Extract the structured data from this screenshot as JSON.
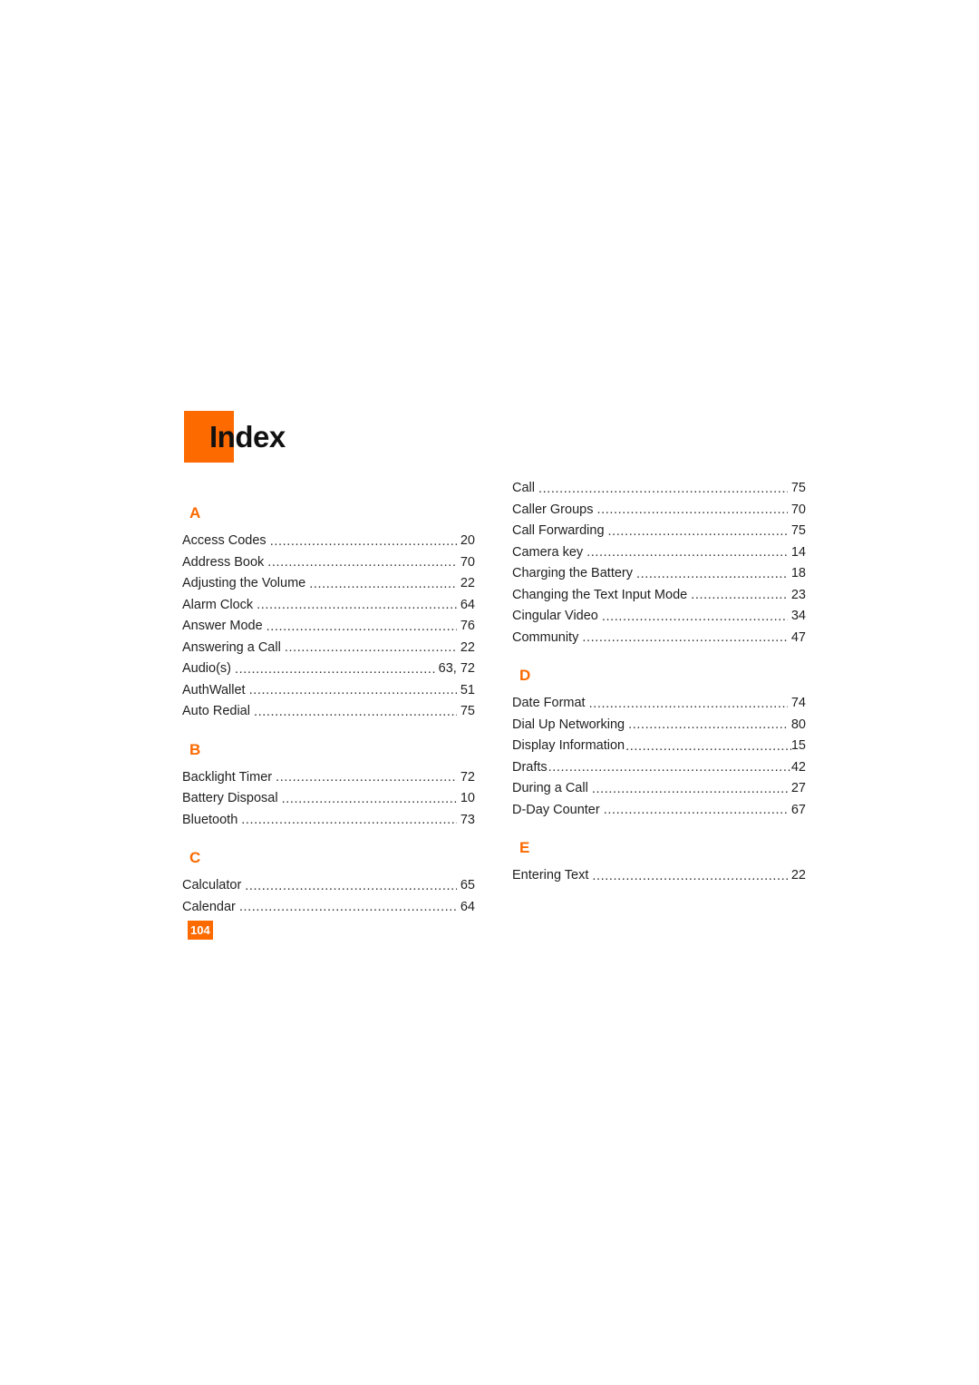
{
  "document": {
    "title": "Index",
    "page_number": "104",
    "accent_color": "#FC6A00",
    "text_color": "#1f1f1f"
  },
  "columns": {
    "left": {
      "sections": [
        {
          "letter": "A",
          "entries": [
            {
              "label": "Access Codes",
              "page": "20"
            },
            {
              "label": "Address Book",
              "page": "70"
            },
            {
              "label": "Adjusting the Volume",
              "page": "22"
            },
            {
              "label": "Alarm Clock",
              "page": "64"
            },
            {
              "label": "Answer Mode",
              "page": "76"
            },
            {
              "label": "Answering a Call",
              "page": "22"
            },
            {
              "label": "Audio(s)",
              "page": "63, 72"
            },
            {
              "label": "AuthWallet",
              "page": "51"
            },
            {
              "label": "Auto Redial",
              "page": "75"
            }
          ]
        },
        {
          "letter": "B",
          "entries": [
            {
              "label": "Backlight Timer",
              "page": "72"
            },
            {
              "label": "Battery Disposal",
              "page": "10"
            },
            {
              "label": "Bluetooth",
              "page": "73"
            }
          ]
        },
        {
          "letter": "C",
          "entries": [
            {
              "label": "Calculator",
              "page": "65"
            },
            {
              "label": "Calendar",
              "page": "64"
            }
          ]
        }
      ]
    },
    "right": {
      "sections": [
        {
          "letter": "",
          "continued": true,
          "entries": [
            {
              "label": "Call",
              "page": "75"
            },
            {
              "label": "Caller Groups",
              "page": "70"
            },
            {
              "label": "Call Forwarding",
              "page": "75"
            },
            {
              "label": "Camera key",
              "page": "14"
            },
            {
              "label": "Charging the Battery",
              "page": "18"
            },
            {
              "label": "Changing the Text Input Mode",
              "page": "23"
            },
            {
              "label": "Cingular Video",
              "page": "34"
            },
            {
              "label": "Community",
              "page": "47"
            }
          ]
        },
        {
          "letter": "D",
          "entries": [
            {
              "label": "Date Format",
              "page": "74"
            },
            {
              "label": "Dial Up Networking",
              "page": "80"
            },
            {
              "label": "Display Information",
              "page": "15",
              "tight": true
            },
            {
              "label": "Drafts",
              "page": "42",
              "tight": true
            },
            {
              "label": "During a Call",
              "page": "27"
            },
            {
              "label": "D-Day Counter",
              "page": "67"
            }
          ]
        },
        {
          "letter": "E",
          "entries": [
            {
              "label": "Entering Text",
              "page": "22"
            }
          ]
        }
      ]
    }
  }
}
